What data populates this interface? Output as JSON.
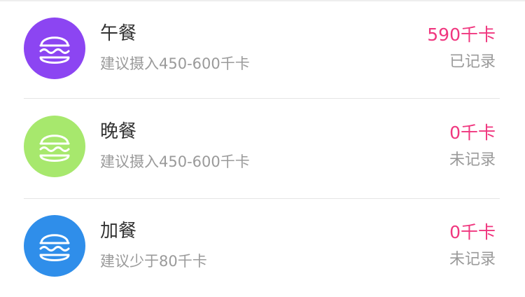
{
  "meals": [
    {
      "name": "午餐",
      "suggestion": "建议摄入450-600千卡",
      "kcal": "590千卡",
      "status": "已记录",
      "icon": "burger-icon",
      "icon_color": "#8c45f2"
    },
    {
      "name": "晚餐",
      "suggestion": "建议摄入450-600千卡",
      "kcal": "0千卡",
      "status": "未记录",
      "icon": "burger-icon",
      "icon_color": "#a7e86d"
    },
    {
      "name": "加餐",
      "suggestion": "建议少于80千卡",
      "kcal": "0千卡",
      "status": "未记录",
      "icon": "burger-icon",
      "icon_color": "#2f8eea"
    }
  ],
  "colors": {
    "kcal": "#f0377f",
    "secondary_text": "#9a9a9a",
    "primary_text": "#333333",
    "divider": "#e5e5e5"
  }
}
